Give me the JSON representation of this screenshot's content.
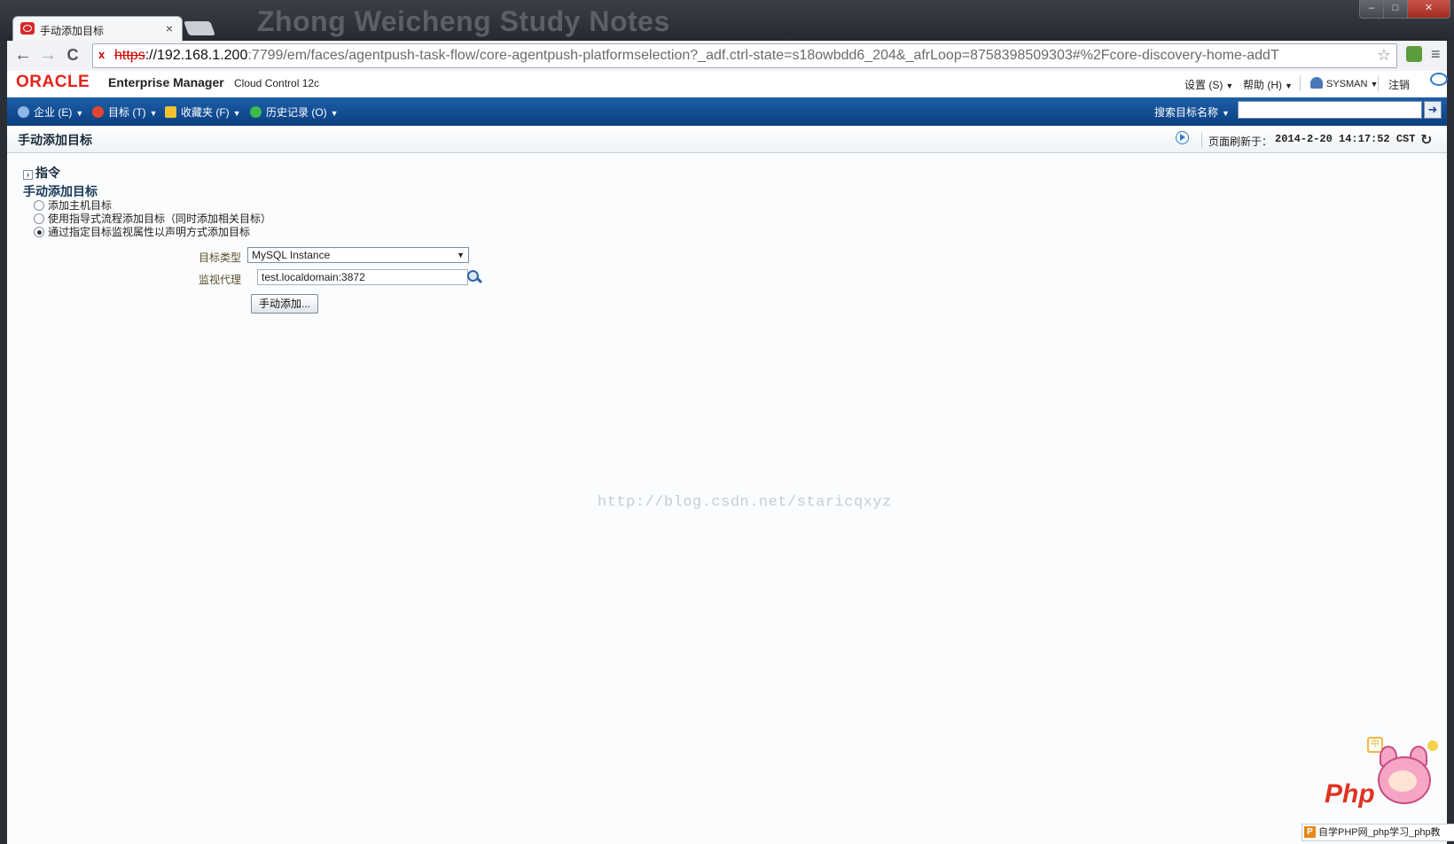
{
  "browser": {
    "window_title_watermark": "Zhong Weicheng Study Notes",
    "tab_title": "手动添加目标",
    "tab_close": "×",
    "window_controls": {
      "min": "–",
      "max": "□",
      "close": "✕"
    },
    "nav": {
      "back": "←",
      "forward": "→",
      "reload": "C"
    },
    "address": {
      "scheme": "https",
      "host": "://192.168.1.200",
      "rest": ":7799/em/faces/agentpush-task-flow/core-agentpush-platformselection?_adf.ctrl-state=s18owbdd6_204&_afrLoop=8758398509303#%2Fcore-discovery-home-addT",
      "star": "☆",
      "warning_icon": "x"
    },
    "menu_icon": "≡"
  },
  "brand": {
    "oracle": "ORACLE",
    "product": "Enterprise Manager",
    "edition": "Cloud Control 12c"
  },
  "global_menu": {
    "settings": "设置 (S)",
    "help": "帮助 (H)",
    "user": "SYSMAN",
    "logout": "注销"
  },
  "navbar": {
    "items": [
      {
        "label": "企业 (E)",
        "icon": "enterprise-icon",
        "color": "#8fb6e8"
      },
      {
        "label": "目标 (T)",
        "icon": "targets-icon",
        "color": "#e2462d"
      },
      {
        "label": "收藏夹 (F)",
        "icon": "star-icon",
        "color": "#f1c232"
      },
      {
        "label": "历史记录 (O)",
        "icon": "history-icon",
        "color": "#3cba4a"
      }
    ],
    "search_label": "搜索目标名称",
    "search_value": "",
    "go": "➜"
  },
  "page_header": {
    "title": "手动添加目标",
    "refresh_label": "页面刷新于：",
    "refresh_value": "2014-2-20 14:17:52 CST",
    "refresh_icon": "↻"
  },
  "content": {
    "instructions": "指令",
    "disclose": "›",
    "section_title": "手动添加目标",
    "options": [
      {
        "label": "添加主机目标",
        "selected": false
      },
      {
        "label": "使用指导式流程添加目标（同时添加相关目标）",
        "selected": false
      },
      {
        "label": "通过指定目标监视属性以声明方式添加目标",
        "selected": true
      }
    ],
    "target_type_label": "目标类型",
    "target_type_value": "MySQL Instance",
    "agent_label": "监视代理",
    "agent_value": "test.localdomain:3872",
    "add_button": "手动添加..."
  },
  "watermarks": {
    "blog_url": "http://blog.csdn.net/staricqxyz",
    "php_logo": "Php",
    "php_bar": "自学PHP网_php学习_php教",
    "php_bar_icon": "P",
    "mascot_badge": "中"
  },
  "colors": {
    "navbar": "#0b3f80",
    "oracle_red": "#e4241b",
    "accent_blue": "#2e7bc4"
  }
}
